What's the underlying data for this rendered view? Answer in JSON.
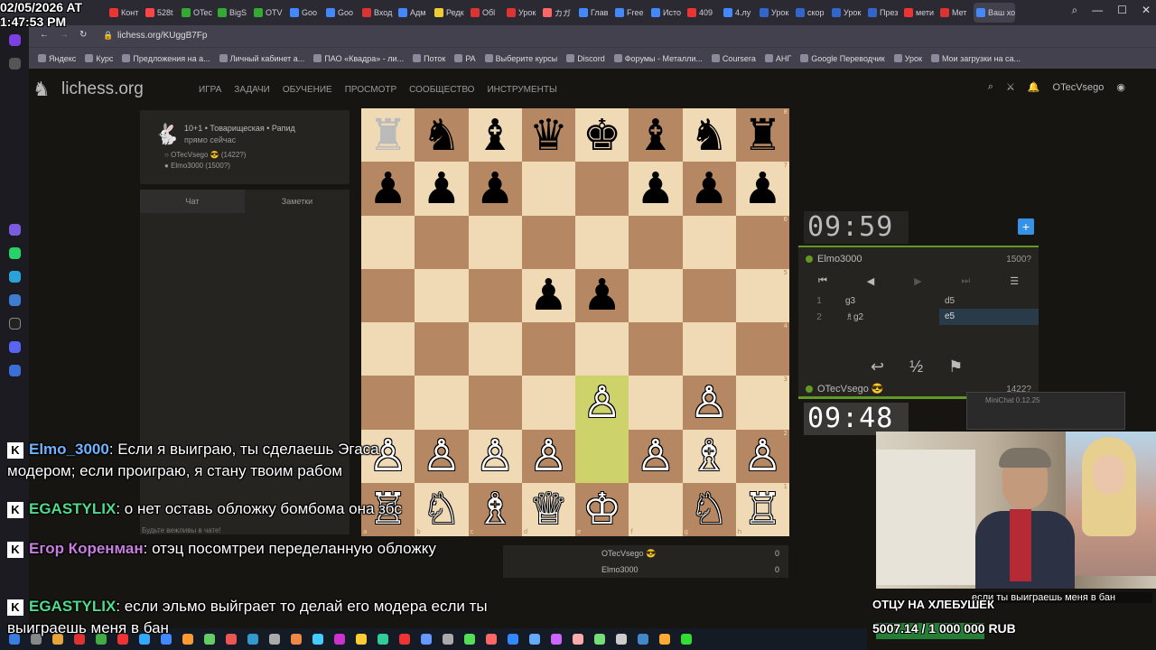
{
  "stamp": {
    "date": "02/05/2026 AT",
    "time": "1:47:53 PM"
  },
  "browser": {
    "url": "lichess.org/KUggB7Fp",
    "tabs": [
      "Конт",
      "528t",
      "OTec",
      "BigS",
      "OTV",
      "Goo",
      "Goo",
      "Вход",
      "Адм",
      "Редк",
      "Oбl",
      "Урок",
      "カガ",
      "Глав",
      "Free",
      "Исто",
      "409",
      "4.лу",
      "Урок",
      "скор",
      "Урок",
      "През",
      "мети",
      "Мет",
      "Ваш ход"
    ],
    "bookmarks": [
      "Яндекс",
      "Курс",
      "Предложения на а...",
      "Личный кабинет а...",
      "ПАО «Квадра» - ли...",
      "Поток",
      "PA",
      "Выберите курсы",
      "Discord",
      "Форумы - Металли...",
      "Coursera",
      "АНГ",
      "Google Переводчик",
      "Урок",
      "Мои загрузки на са..."
    ]
  },
  "header": {
    "logo": "lichess.org",
    "nav": [
      "ИГРА",
      "ЗАДАЧИ",
      "ОБУЧЕНИЕ",
      "ПРОСМОТР",
      "СООБЩЕСТВО",
      "ИНСТРУМЕНТЫ"
    ],
    "username": "OTecVsego"
  },
  "game_info": {
    "mode": "10+1 • Товарищеская • Рапид",
    "when": "прямо сейчас",
    "white": "OTecVsego 😎 (1422?)",
    "black": "Elmo3000 (1500?)"
  },
  "chat": {
    "tab_chat": "Чат",
    "tab_notes": "Заметки",
    "warning": "Будьте вежливы в чате!"
  },
  "board": {
    "rows": [
      [
        "♜",
        "♞",
        "♝",
        "♛",
        "♚",
        "♝",
        "♞",
        "♜"
      ],
      [
        "♟",
        "♟",
        "♟",
        "",
        "",
        "♟",
        "♟",
        "♟"
      ],
      [
        "",
        "",
        "",
        "",
        "",
        "",
        "",
        ""
      ],
      [
        "",
        "",
        "",
        "♟",
        "♟",
        "",
        "",
        ""
      ],
      [
        "",
        "",
        "",
        "",
        "",
        "",
        "",
        ""
      ],
      [
        "",
        "",
        "",
        "",
        "♙",
        "",
        "♙",
        ""
      ],
      [
        "♙",
        "♙",
        "♙",
        "♙",
        "",
        "♙",
        "♗",
        "♙"
      ],
      [
        "♖",
        "♘",
        "♗",
        "♕",
        "♔",
        "",
        "♘",
        "♖"
      ]
    ],
    "colors": [
      [
        "",
        "b",
        "b",
        "b",
        "b",
        "b",
        "b",
        "b"
      ],
      [
        "b",
        "b",
        "b",
        "",
        "",
        "b",
        "b",
        "b"
      ],
      [
        "",
        "",
        "",
        "",
        "",
        "",
        "",
        ""
      ],
      [
        "",
        "",
        "",
        "b",
        "b",
        "",
        "",
        ""
      ],
      [
        "",
        "",
        "",
        "",
        "",
        "",
        "",
        ""
      ],
      [
        "",
        "",
        "",
        "",
        "w",
        "",
        "w",
        ""
      ],
      [
        "w",
        "w",
        "w",
        "w",
        "",
        "w",
        "w",
        "w"
      ],
      [
        "w",
        "w",
        "w",
        "w",
        "w",
        "",
        "w",
        "w"
      ]
    ],
    "highlights": [
      [
        5,
        4
      ],
      [
        6,
        4
      ]
    ],
    "files": [
      "a",
      "b",
      "c",
      "d",
      "e",
      "f",
      "g",
      "h"
    ],
    "ranks": [
      "8",
      "7",
      "6",
      "5",
      "4",
      "3",
      "2",
      "1"
    ]
  },
  "clocks": {
    "opponent": "09:59",
    "me": "09:48"
  },
  "opponent": {
    "name": "Elmo3000",
    "rating": "1500?"
  },
  "me": {
    "name": "OTecVsego 😎",
    "rating": "1422?"
  },
  "moves": [
    {
      "n": "1",
      "w": "g3",
      "b": "d5"
    },
    {
      "n": "2",
      "w": "♗g2",
      "b": "e5"
    }
  ],
  "scores": [
    {
      "name": "OTecVsego 😎",
      "score": "0"
    },
    {
      "name": "Elmo3000",
      "score": "0"
    }
  ],
  "minichat": "MiniChat 0.12.25",
  "stream": {
    "caption": "ОТЦУ НА ХЛЕБУШЕК",
    "subtext": "если ты выиграешь меня в бан",
    "donation": "5007.14 / 1 000 000 RUB"
  },
  "overlay_chat": [
    {
      "name": "Elmo_3000",
      "text": "Если я выиграю, ты сделаешь Эгаса модером; если проиграю, я стану твоим рабом",
      "color": "#6fb3ff"
    },
    {
      "name": "EGASTYLIX",
      "text": "о нет оставь обложку бомбома она збс",
      "color": "#4ddc8a"
    },
    {
      "name": "Егор Коренман",
      "text": "отэц посомтреи переделанную обложку",
      "color": "#c97de0"
    },
    {
      "name": "EGASTYLIX",
      "text": "если эльмо выйграет то делай его модера если ты выиграешь меня в бан",
      "color": "#4ddc8a"
    }
  ]
}
